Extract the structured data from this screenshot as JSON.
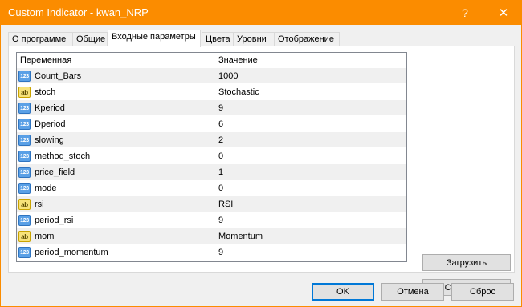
{
  "window": {
    "title": "Custom Indicator - kwan_NRP",
    "help_label": "?",
    "close_label": "✕"
  },
  "tabs": [
    {
      "label": "О программе",
      "active": false
    },
    {
      "label": "Общие",
      "active": false
    },
    {
      "label": "Входные параметры",
      "active": true
    },
    {
      "label": "Цвета",
      "active": false
    },
    {
      "label": "Уровни",
      "active": false
    },
    {
      "label": "Отображение",
      "active": false
    }
  ],
  "grid": {
    "columns": {
      "variable": "Переменная",
      "value": "Значение"
    },
    "rows": [
      {
        "type": "num",
        "icon": "123",
        "name": "Count_Bars",
        "value": "1000"
      },
      {
        "type": "str",
        "icon": "ab",
        "name": "stoch",
        "value": "Stochastic"
      },
      {
        "type": "num",
        "icon": "123",
        "name": "Kperiod",
        "value": "9"
      },
      {
        "type": "num",
        "icon": "123",
        "name": "Dperiod",
        "value": "6"
      },
      {
        "type": "num",
        "icon": "123",
        "name": "slowing",
        "value": "2"
      },
      {
        "type": "num",
        "icon": "123",
        "name": "method_stoch",
        "value": "0"
      },
      {
        "type": "num",
        "icon": "123",
        "name": "price_field",
        "value": "1"
      },
      {
        "type": "num",
        "icon": "123",
        "name": "mode",
        "value": "0"
      },
      {
        "type": "str",
        "icon": "ab",
        "name": "rsi",
        "value": "RSI"
      },
      {
        "type": "num",
        "icon": "123",
        "name": "period_rsi",
        "value": "9"
      },
      {
        "type": "str",
        "icon": "ab",
        "name": "mom",
        "value": "Momentum"
      },
      {
        "type": "num",
        "icon": "123",
        "name": "period_momentum",
        "value": "9"
      }
    ]
  },
  "side_buttons": {
    "load": "Загрузить",
    "save": "Сохранить"
  },
  "dialog_buttons": {
    "ok": "OK",
    "cancel": "Отмена",
    "reset": "Сброс"
  },
  "colors": {
    "titlebar": "#fb8c00",
    "row_alt": "#f0f0f0",
    "num_icon": "#5aa0e6",
    "str_icon": "#f7e27a"
  }
}
